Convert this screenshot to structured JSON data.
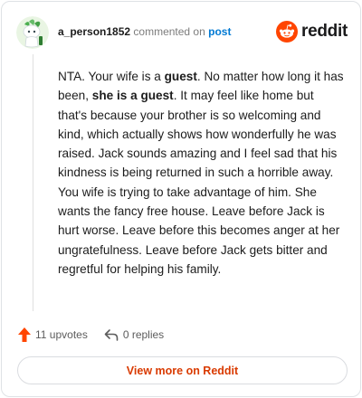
{
  "comment": {
    "username": "a_person1852",
    "action_text": "commented on",
    "post_link": "post",
    "body": {
      "p1": "NTA. Your wife is a ",
      "b1": "guest",
      "p2": ". No matter how long it has been, ",
      "b2": "she is a guest",
      "p3": ". It may feel like home but that's because your brother is so welcoming and kind, which actually shows how wonderfully he was raised. Jack sounds amazing and I feel sad that his kindness is being returned in such a horrible away. You wife is trying to take advantage of him. She wants the fancy free house. Leave before Jack is hurt worse. Leave before this becomes anger at her ungratefulness. Leave before Jack gets bitter and regretful for helping his family."
    }
  },
  "brand": {
    "wordmark": "reddit",
    "icon": "reddit-snoo-icon",
    "color": "#ff4500"
  },
  "actions": {
    "upvotes": "11 upvotes",
    "replies": "0 replies"
  },
  "cta": {
    "label": "View more on Reddit"
  },
  "colors": {
    "accent": "#ff4500",
    "link": "#0079d3",
    "cta_text": "#d93a00"
  }
}
